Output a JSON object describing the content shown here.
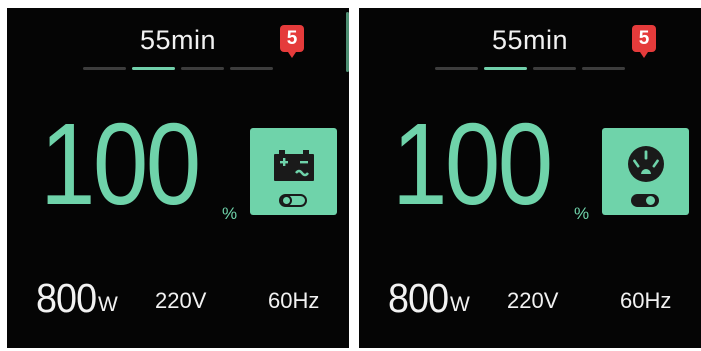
{
  "screens": [
    {
      "time_remaining": "55min",
      "notification_count": "5",
      "pages": [
        false,
        true,
        false,
        false
      ],
      "battery_percent_value": "100",
      "battery_percent_unit": "%",
      "mode": "dc-output",
      "mode_icon": "car-battery-icon",
      "toggle_state": "off",
      "output_power_value": "800",
      "output_power_unit": "W",
      "voltage": "220V",
      "frequency": "60Hz"
    },
    {
      "time_remaining": "55min",
      "notification_count": "5",
      "pages": [
        false,
        true,
        false,
        false
      ],
      "battery_percent_value": "100",
      "battery_percent_unit": "%",
      "mode": "ac-output",
      "mode_icon": "ac-outlet-icon",
      "toggle_state": "on",
      "output_power_value": "800",
      "output_power_unit": "W",
      "voltage": "220V",
      "frequency": "60Hz"
    }
  ],
  "colors": {
    "accent": "#6fd3aa",
    "background": "#050505",
    "badge": "#e53b3b",
    "text": "#f2f2f2"
  }
}
